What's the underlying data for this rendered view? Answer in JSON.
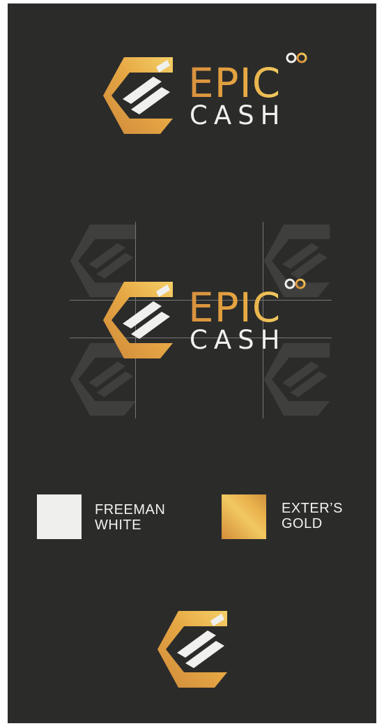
{
  "logo": {
    "wordmark_top": "EPIC",
    "wordmark_bottom": "CASH",
    "symbol_icon": "infinity-icon",
    "mark_icon": "hexagon-e-icon"
  },
  "colors": {
    "background": "#2b2b2a",
    "gold_dark": "#d08d3f",
    "gold_light": "#f3cd63",
    "white": "#efefed"
  },
  "palette": [
    {
      "line1": "FREEMAN",
      "line2": "WHITE",
      "color": "#efefed"
    },
    {
      "line1": "EXTER’S",
      "line2": "GOLD",
      "color": "#e0a444"
    }
  ]
}
